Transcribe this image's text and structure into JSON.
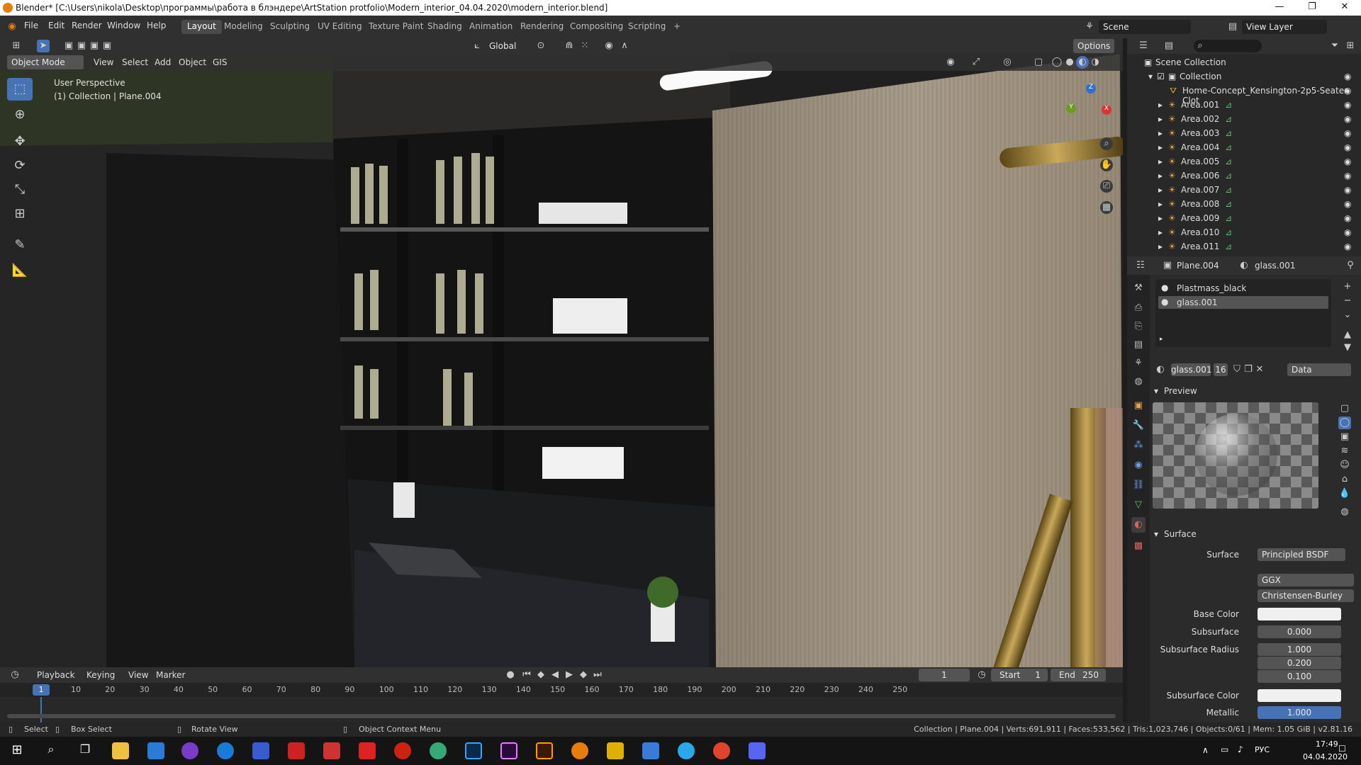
{
  "window": {
    "title": "Blender* [C:\\Users\\nikola\\Desktop\\программы\\работа в блэндере\\ArtStation protfolio\\Modern_interior_04.04.2020\\modern_interior.blend]",
    "minimize": "—",
    "maximize": "❐",
    "close": "✕"
  },
  "menus": [
    "File",
    "Edit",
    "Render",
    "Window",
    "Help"
  ],
  "workspaces": [
    "Layout",
    "Modeling",
    "Sculpting",
    "UV Editing",
    "Texture Paint",
    "Shading",
    "Animation",
    "Rendering",
    "Compositing",
    "Scripting",
    "+"
  ],
  "scene": {
    "label": "Scene",
    "view_layer": "View Layer"
  },
  "viewport_header": {
    "mode": "Object Mode",
    "menus": [
      "View",
      "Select",
      "Add",
      "Object",
      "GIS"
    ],
    "orientation": "Global",
    "options": "Options"
  },
  "viewport": {
    "perspective": "User Perspective",
    "collection": "(1) Collection | Plane.004"
  },
  "gizmo": {
    "z": "Z",
    "x": "X",
    "y": "Y"
  },
  "outliner": {
    "scene_collection": "Scene Collection",
    "collection": "Collection",
    "items": [
      "Home-Concept_Kensington-2p5-Seater-Clot",
      "Area.001",
      "Area.002",
      "Area.003",
      "Area.004",
      "Area.005",
      "Area.006",
      "Area.007",
      "Area.008",
      "Area.009",
      "Area.010",
      "Area.011"
    ]
  },
  "properties": {
    "object": "Plane.004",
    "material": "glass.001",
    "slots": [
      "Plastmass_black",
      "glass.001"
    ],
    "mat_name": "glass.001",
    "users": "16",
    "link": "Data",
    "preview_label": "Preview",
    "surface_label": "Surface",
    "rows": {
      "surface_l": "Surface",
      "surface_v": "Principled BSDF",
      "dist": "GGX",
      "sss_method": "Christensen-Burley",
      "base_color_l": "Base Color",
      "subsurface_l": "Subsurface",
      "subsurface_v": "0.000",
      "ss_radius_l": "Subsurface Radius",
      "ssr1": "1.000",
      "ssr2": "0.200",
      "ssr3": "0.100",
      "ss_color_l": "Subsurface Color",
      "metallic_l": "Metallic",
      "metallic_v": "1.000"
    }
  },
  "timeline": {
    "menus": [
      "Playback",
      "Keying",
      "View",
      "Marker"
    ],
    "current": "1",
    "start_l": "Start",
    "start_v": "1",
    "end_l": "End",
    "end_v": "250",
    "ticks": [
      "10",
      "20",
      "30",
      "40",
      "50",
      "60",
      "70",
      "80",
      "90",
      "100",
      "110",
      "120",
      "130",
      "140",
      "150",
      "160",
      "170",
      "180",
      "190",
      "200",
      "210",
      "220",
      "230",
      "240",
      "250"
    ],
    "frame_marker": "1"
  },
  "status": {
    "select": "Select",
    "box": "Box Select",
    "rotate": "Rotate View",
    "context": "Object Context Menu",
    "stats": "Collection | Plane.004 | Verts:691,911 | Faces:533,562 | Tris:1,023,746 | Objects:0/61 | Mem: 1.05 GiB | v2.81.16"
  },
  "taskbar": {
    "lang": "РУС",
    "time": "17:49",
    "date": "04.04.2020"
  },
  "colors": {
    "accent": "#4772b3",
    "orange": "#e87d0d",
    "panel": "#303030"
  }
}
